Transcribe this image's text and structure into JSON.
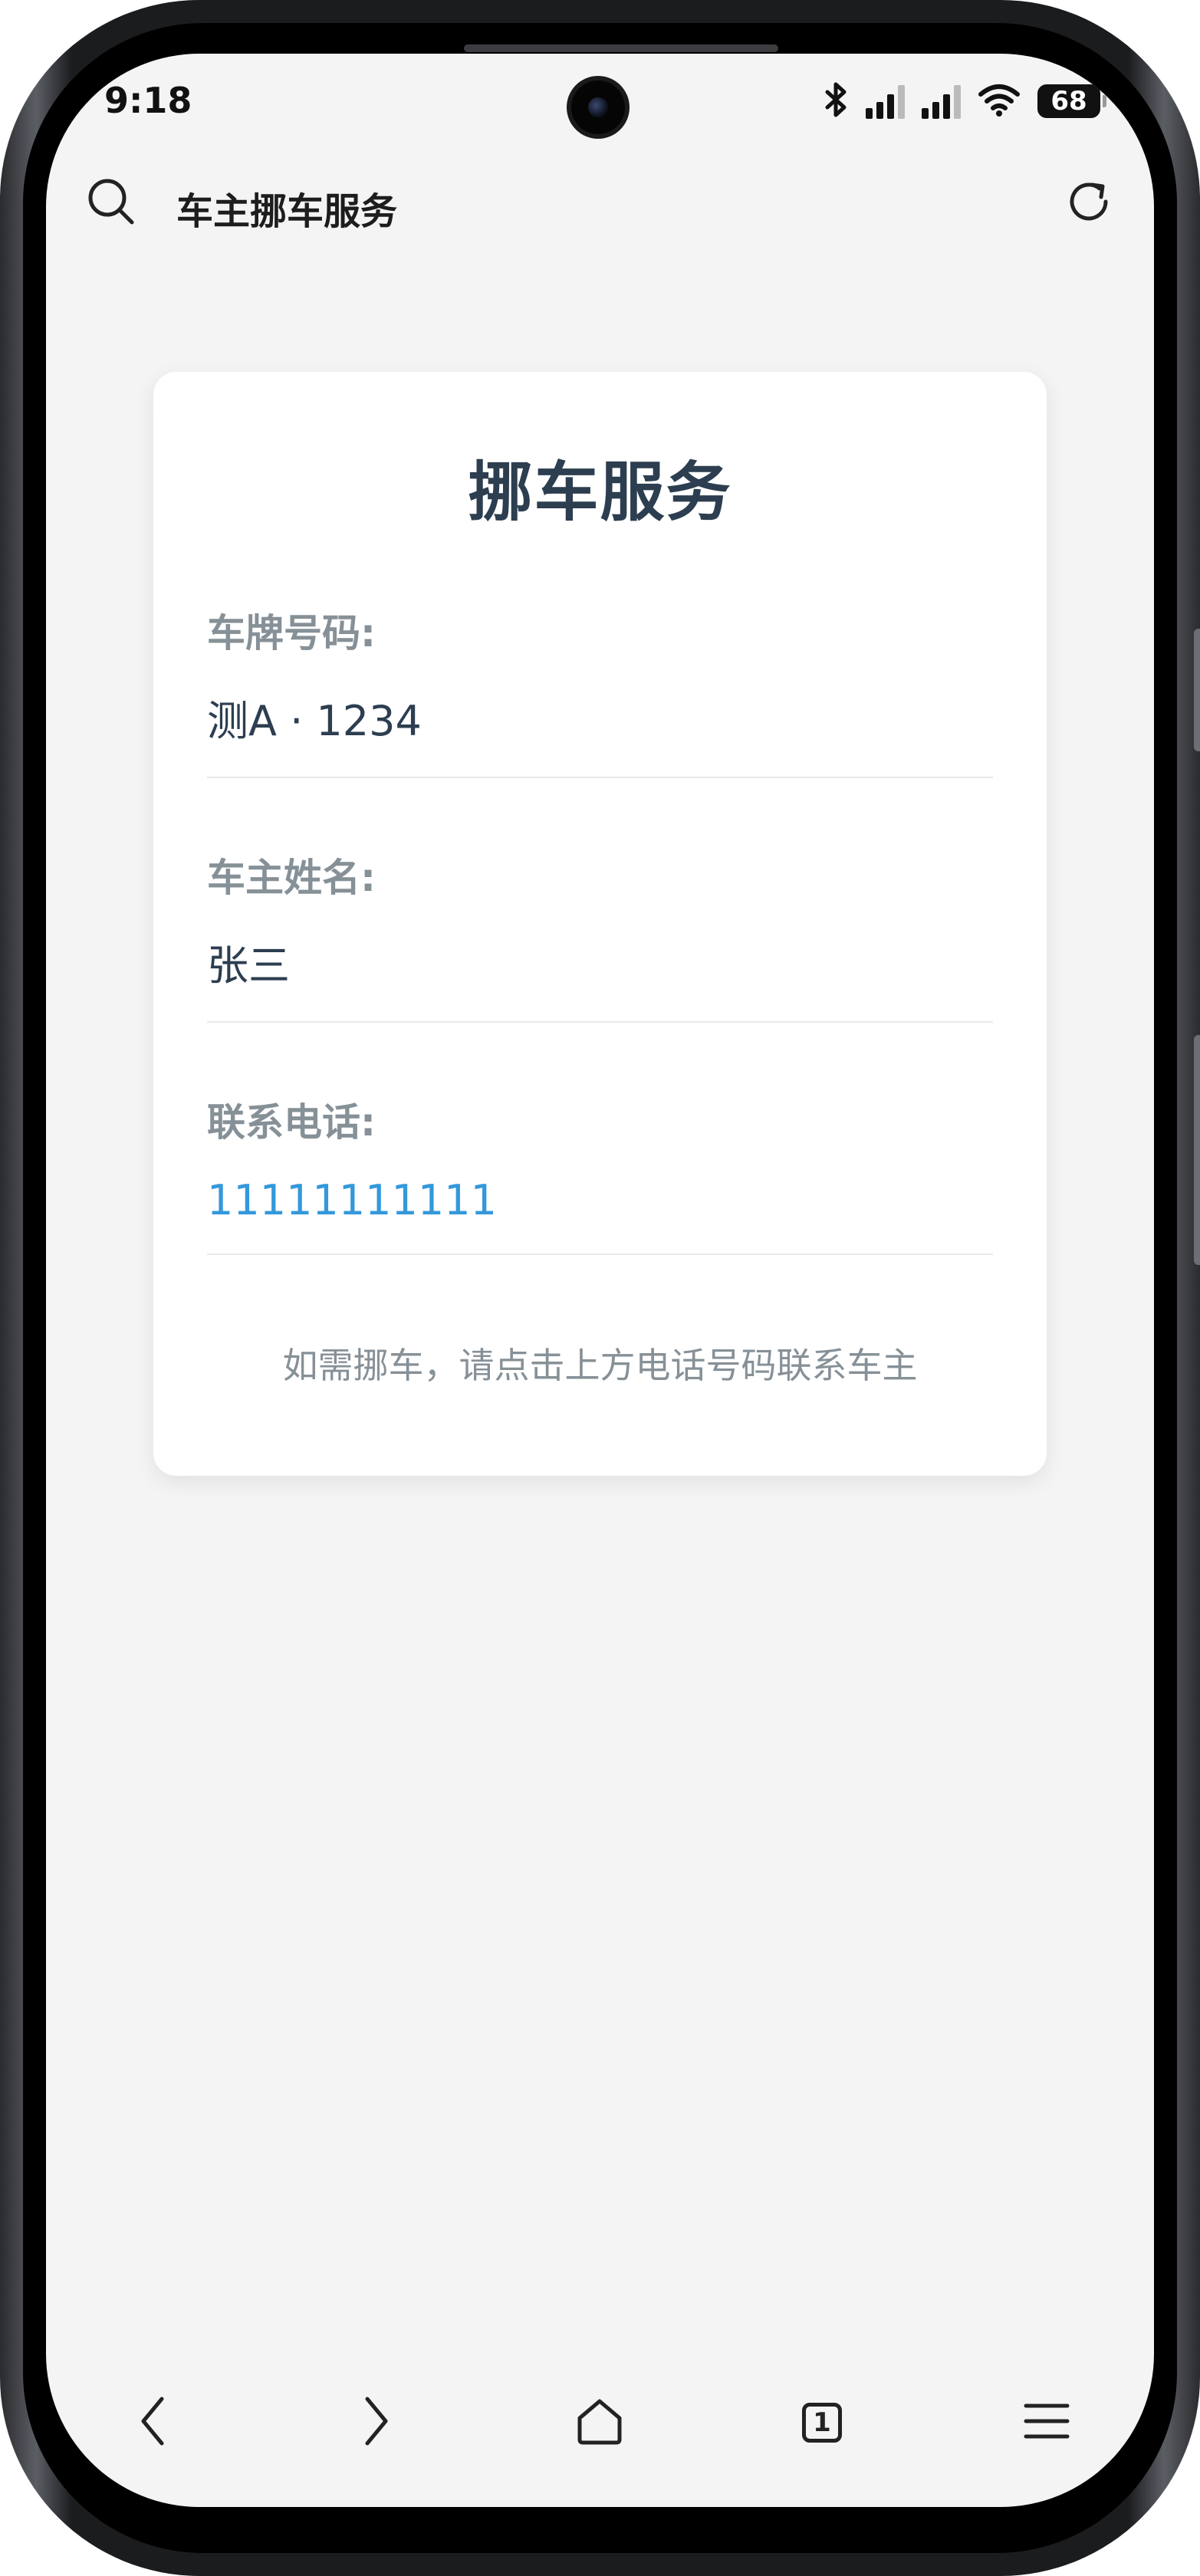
{
  "status_bar": {
    "time": "9:18",
    "battery": "68",
    "icons": [
      "bluetooth-icon",
      "signal-icon",
      "signal-icon",
      "wifi-icon",
      "battery-icon"
    ]
  },
  "browser": {
    "page_title": "车主挪车服务",
    "icons": [
      "search-icon",
      "refresh-icon"
    ]
  },
  "card": {
    "title": "挪车服务",
    "fields": [
      {
        "label": "车牌号码:",
        "value": "测A · 1234"
      },
      {
        "label": "车主姓名:",
        "value": "张三"
      },
      {
        "label": "联系电话:",
        "value": "11111111111"
      }
    ],
    "hint": "如需挪车，请点击上方电话号码联系车主"
  },
  "nav": {
    "tab_count": "1",
    "icons": [
      "back-icon",
      "forward-icon",
      "home-icon",
      "tabs-icon",
      "menu-icon"
    ]
  },
  "colors": {
    "title": "#2c3e50",
    "label": "#869097",
    "link": "#3498db",
    "background": "#f4f4f4"
  }
}
